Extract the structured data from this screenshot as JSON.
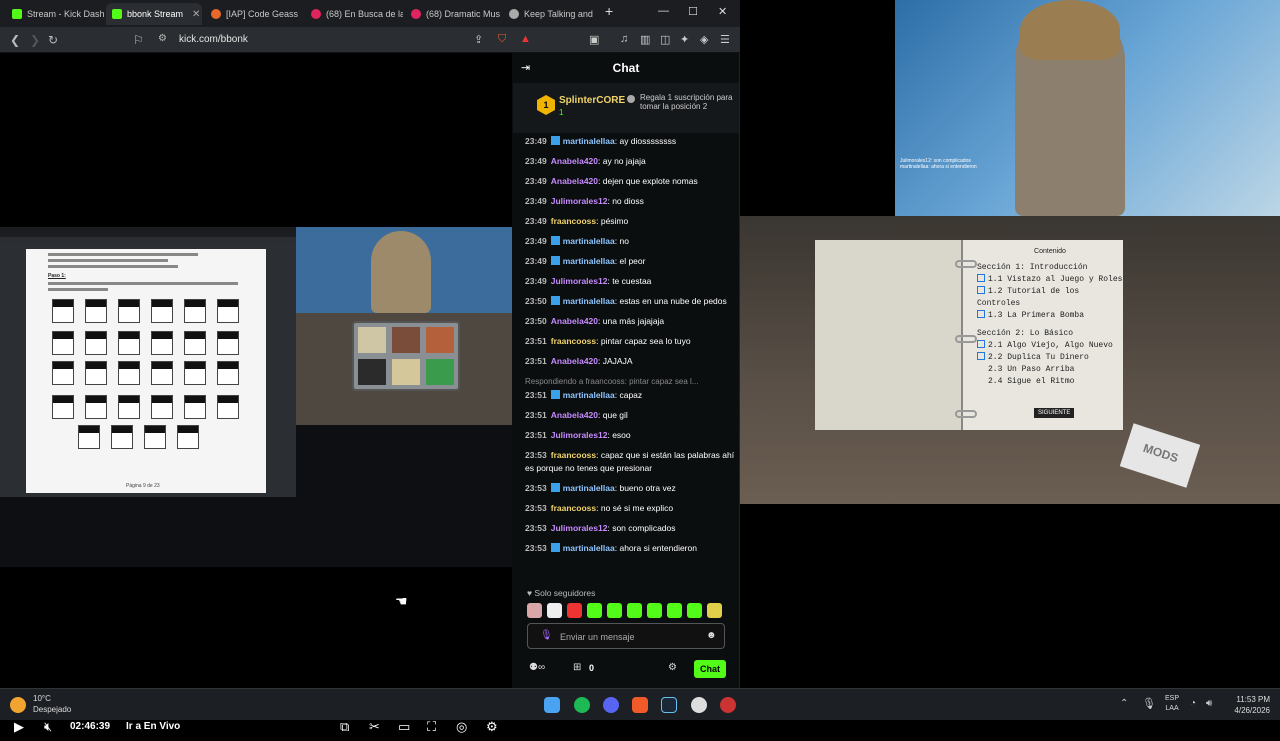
{
  "browser": {
    "tabs": [
      {
        "label": "Stream - Kick Dash",
        "color": "#53fc18"
      },
      {
        "label": "bbonk Stream",
        "color": "#53fc18",
        "active": true
      },
      {
        "label": "[IAP] Code Geass",
        "color": "#e8672a"
      },
      {
        "label": "(68) En Busca de la",
        "color": "#e0245e"
      },
      {
        "label": "(68) Dramatic Mus",
        "color": "#e0245e"
      },
      {
        "label": "Keep Talking and",
        "color": "#aaa"
      }
    ],
    "new_tab": "+",
    "url": "kick.com/bbonk"
  },
  "player": {
    "time": "02:46:39",
    "live_label": "Ir a En Vivo",
    "progress": 0.965
  },
  "document": {
    "step_label": "Paso 1:",
    "page_footer": "Página 9 de 23"
  },
  "chat": {
    "title": "Chat",
    "gift": {
      "user": "SplinterCORE",
      "rank": "1",
      "count": "1",
      "text": "Regala 1 suscripción para tomar la posición 2"
    },
    "messages": [
      {
        "time": "23:49",
        "user": "martinalellaa",
        "color": "blue",
        "mod": true,
        "text": "ay diossssssss"
      },
      {
        "time": "23:49",
        "user": "Anabela420",
        "color": "purple",
        "text": "ay no jajaja"
      },
      {
        "time": "23:49",
        "user": "Anabela420",
        "color": "purple",
        "text": "dejen que explote nomas"
      },
      {
        "time": "23:49",
        "user": "Julimorales12",
        "color": "purple",
        "text": "no dioss"
      },
      {
        "time": "23:49",
        "user": "fraancooss",
        "color": "yellow",
        "text": "pésimo"
      },
      {
        "time": "23:49",
        "user": "martinalellaa",
        "color": "blue",
        "mod": true,
        "text": "no"
      },
      {
        "time": "23:49",
        "user": "martinalellaa",
        "color": "blue",
        "mod": true,
        "text": "el peor"
      },
      {
        "time": "23:49",
        "user": "Julimorales12",
        "color": "purple",
        "text": "te cuestaa"
      },
      {
        "time": "23:50",
        "user": "martinalellaa",
        "color": "blue",
        "mod": true,
        "text": "estas en una nube de pedos"
      },
      {
        "time": "23:50",
        "user": "Anabela420",
        "color": "purple",
        "text": "una más jajajaja"
      },
      {
        "time": "23:51",
        "user": "fraancooss",
        "color": "yellow",
        "text": "pintar capaz sea lo tuyo"
      },
      {
        "time": "23:51",
        "user": "Anabela420",
        "color": "purple",
        "text": "JAJAJA"
      },
      {
        "time": "23:51",
        "user": "martinalellaa",
        "color": "blue",
        "mod": true,
        "reply": "Respondiendo a fraancooss: pintar capaz sea l...",
        "text": "capaz"
      },
      {
        "time": "23:51",
        "user": "Anabela420",
        "color": "purple",
        "text": "que gil"
      },
      {
        "time": "23:51",
        "user": "Julimorales12",
        "color": "purple",
        "text": "esoo"
      },
      {
        "time": "23:53",
        "user": "fraancooss",
        "color": "yellow",
        "text": "capaz que si están las palabras ahí es porque no tenes que presionar"
      },
      {
        "time": "23:53",
        "user": "martinalellaa",
        "color": "blue",
        "mod": true,
        "text": "bueno otra vez"
      },
      {
        "time": "23:53",
        "user": "fraancooss",
        "color": "yellow",
        "text": "no sé si me explico"
      },
      {
        "time": "23:53",
        "user": "Julimorales12",
        "color": "purple",
        "text": "son complicados"
      },
      {
        "time": "23:53",
        "user": "martinalellaa",
        "color": "blue",
        "mod": true,
        "text": "ahora si entendieron"
      }
    ],
    "followers_only": "Solo seguidores",
    "input_placeholder": "Enviar un mensaje",
    "points": "0",
    "send_label": "Chat"
  },
  "game": {
    "contents_title": "Contenido",
    "sections": [
      {
        "label": "Sección 1: Introducción",
        "items": [
          {
            "num": "1.1",
            "label": "Vistazo al Juego y Roles",
            "checked": true
          },
          {
            "num": "1.2",
            "label": "Tutorial de los Controles",
            "checked": true
          },
          {
            "num": "1.3",
            "label": "La Primera Bomba",
            "checked": true
          }
        ]
      },
      {
        "label": "Sección 2: Lo Básico",
        "items": [
          {
            "num": "2.1",
            "label": "Algo Viejo, Algo Nuevo",
            "checked": true
          },
          {
            "num": "2.2",
            "label": "Duplica Tu Dinero",
            "checked": true
          },
          {
            "num": "2.3",
            "label": "Un Paso Arriba",
            "checked": false
          },
          {
            "num": "2.4",
            "label": "Sigue el Ritmo",
            "checked": false
          }
        ]
      }
    ],
    "next_label": "SIGUIENTE",
    "mods_label": "MODS",
    "overlay_lines": [
      "Julimorales12: son complicados",
      "martinalellaa: ahora si entendieron"
    ]
  },
  "taskbar": {
    "temperature": "10°C",
    "weather": "Despejado",
    "lang": "ESP",
    "lang2": "LAA",
    "time": "11:53 PM",
    "date": "4/26/2026"
  }
}
